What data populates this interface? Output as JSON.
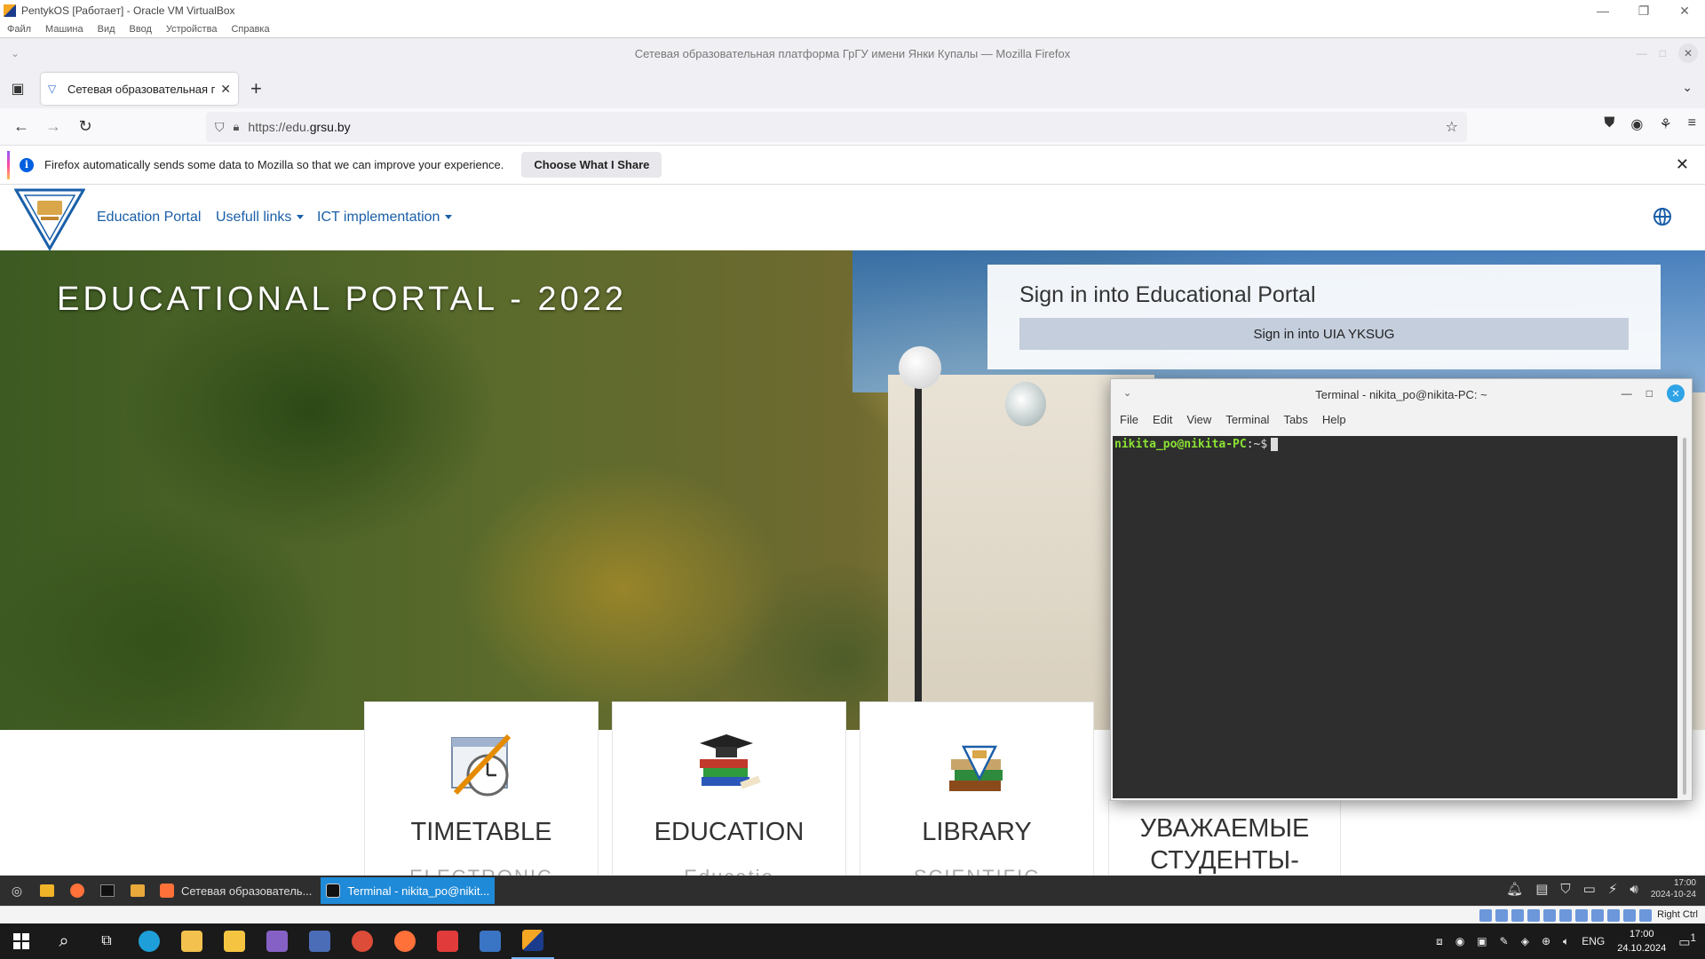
{
  "vbox": {
    "title": "PentykOS [Работает] - Oracle VM VirtualBox",
    "menu": [
      "Файл",
      "Машина",
      "Вид",
      "Ввод",
      "Устройства",
      "Справка"
    ],
    "host_key": "Right Ctrl"
  },
  "firefox": {
    "window_title": "Сетевая образовательная платформа ГрГУ имени Янки Купалы — Mozilla Firefox",
    "tab_title": "Сетевая образовательная платформа ГрГУ",
    "url_scheme": "https://edu.",
    "url_host": "grsu.by",
    "notification": {
      "text": "Firefox automatically sends some data to Mozilla so that we can improve your experience.",
      "button": "Choose What I Share"
    }
  },
  "site": {
    "nav": [
      "Education Portal",
      "Usefull links",
      "ICT implementation"
    ],
    "hero_title": "EDUCATIONAL PORTAL - 2022",
    "signin_title": "Sign in into Educational Portal",
    "signin_button": "Sign in into UIA YKSUG",
    "cards": [
      {
        "title": "TIMETABLE",
        "subtitle": "ELECTRONIC",
        "icon": "timetable-icon"
      },
      {
        "title": "EDUCATION",
        "subtitle": "Educatio",
        "icon": "graduation-books-icon"
      },
      {
        "title": "LIBRARY",
        "subtitle": "SCIENTIFIC",
        "icon": "library-books-icon"
      }
    ],
    "notice_title": "УВАЖАЕМЫЕ СТУДЕНТЫ-"
  },
  "terminal": {
    "title": "Terminal - nikita_po@nikita-PC: ~",
    "menu": [
      "File",
      "Edit",
      "View",
      "Terminal",
      "Tabs",
      "Help"
    ],
    "prompt_user": "nikita_po@nikita-PC",
    "prompt_path": ":~$"
  },
  "guest_taskbar": {
    "windows": [
      {
        "label": "Сетевая образователь...",
        "active": false
      },
      {
        "label": "Terminal - nikita_po@nikit...",
        "active": true
      }
    ],
    "time": "17:00",
    "date": "2024-10-24"
  },
  "windows_taskbar": {
    "language": "ENG",
    "time": "17:00",
    "date": "24.10.2024",
    "notifications": "1"
  },
  "colors": {
    "link": "#1a5fa8",
    "terminal_prompt": "#8ae234",
    "active_task": "#1f8ad7"
  }
}
